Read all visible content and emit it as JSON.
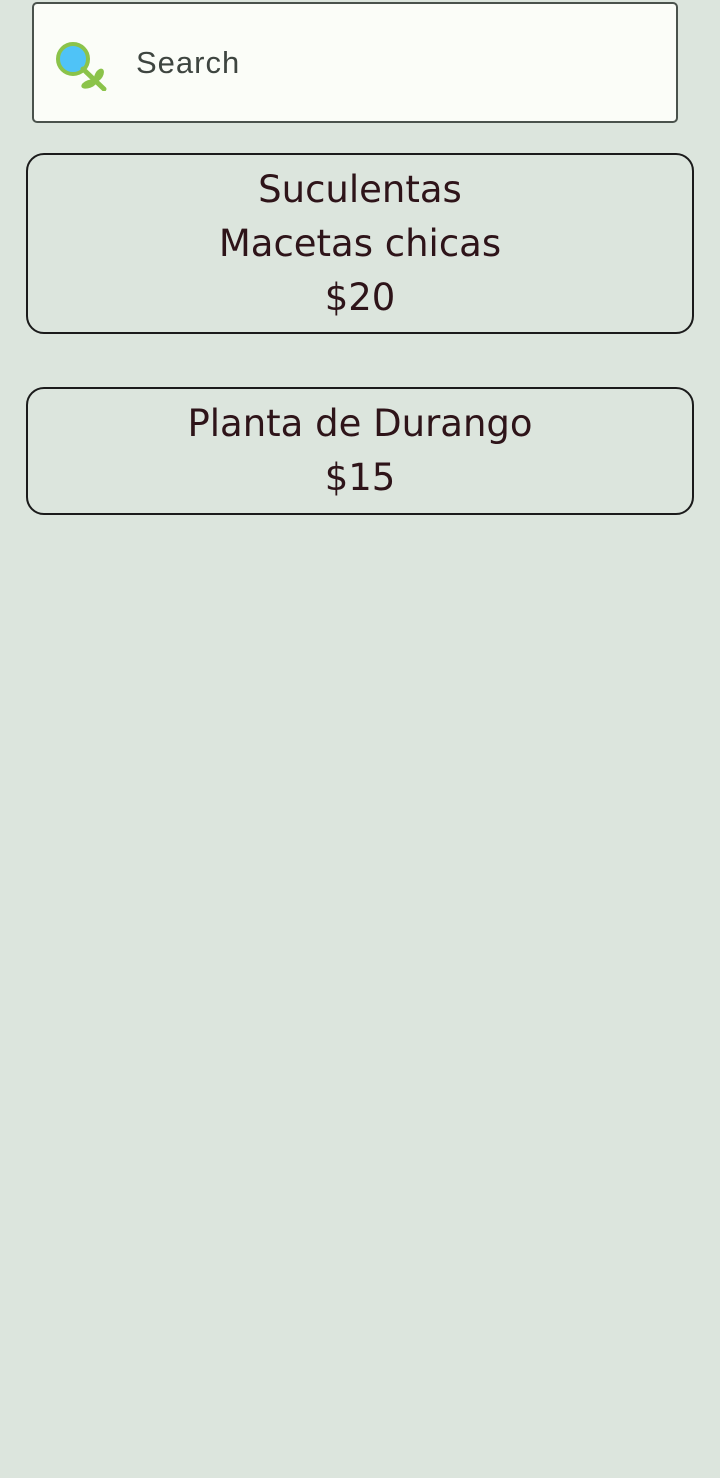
{
  "search": {
    "placeholder": "Search",
    "icon": "plant-search-icon"
  },
  "products": [
    {
      "name": "Suculentas",
      "subtitle": "Macetas chicas",
      "price": "$20"
    },
    {
      "name": "Planta de Durango",
      "price": "$15"
    }
  ],
  "colors": {
    "background": "#dce5dd",
    "search_background": "#fbfdf8",
    "text": "#2e1419",
    "icon_blue": "#4fc3f7",
    "icon_green": "#8bc34a"
  }
}
